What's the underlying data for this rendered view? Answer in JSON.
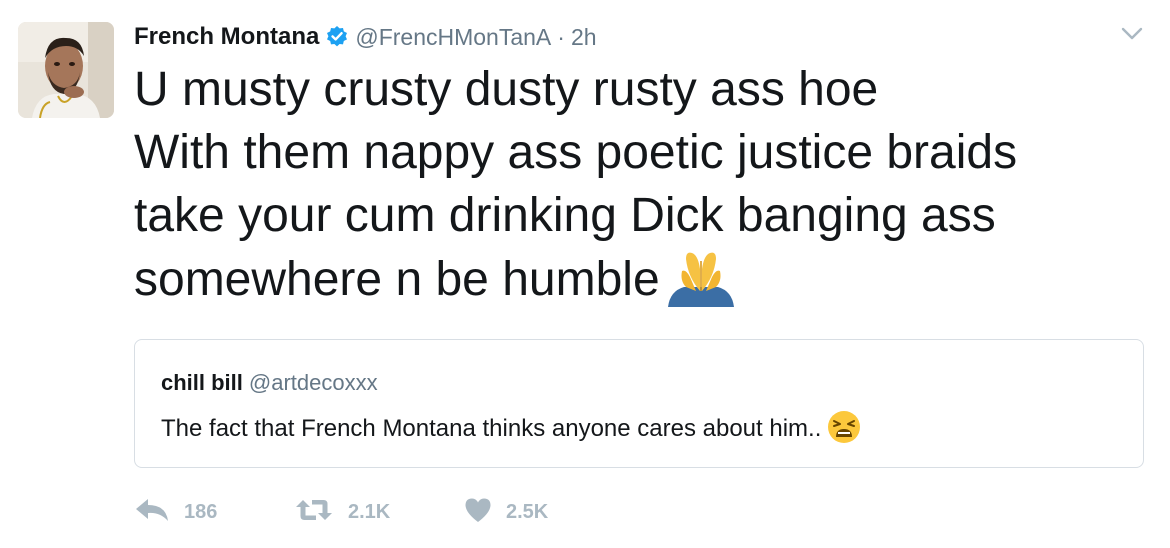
{
  "tweet": {
    "author": {
      "display_name": "French Montana",
      "handle": "@FrencHMonTanA",
      "verified": true
    },
    "separator": "·",
    "time": "2h",
    "text_lines": [
      "U musty crusty dusty rusty ass hoe",
      "With them nappy ass poetic justice braids",
      "take your cum drinking Dick banging ass",
      "somewhere n be humble"
    ],
    "text_emoji": "folded-hands-emoji",
    "quoted_tweet": {
      "display_name": "chill bill",
      "handle": "@artdecoxxx",
      "text": "The fact that French Montana thinks anyone cares about him..",
      "emoji": "tired-face-emoji"
    },
    "actions": {
      "reply_count": "186",
      "retweet_count": "2.1K",
      "like_count": "2.5K"
    }
  },
  "colors": {
    "text": "#14171a",
    "secondary": "#657786",
    "action_gray": "#aab8c2",
    "verified_blue": "#1da1f2",
    "border": "#d8dee4"
  }
}
